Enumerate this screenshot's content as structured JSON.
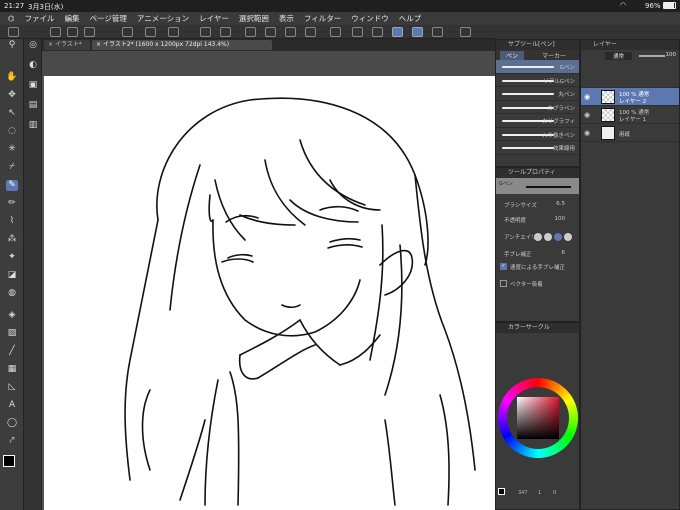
{
  "status": {
    "time": "21:27",
    "date": "3月3日(水)",
    "battery": "96%"
  },
  "menu": [
    "ファイル",
    "編集",
    "ページ管理",
    "アニメーション",
    "レイヤー",
    "選択範囲",
    "表示",
    "フィルター",
    "ウィンドウ",
    "ヘルプ"
  ],
  "tabs": [
    {
      "label": "イラスト*"
    },
    {
      "label": "イラスト2* (1600 x 1200px 72dpi 143.4%)"
    }
  ],
  "subtool_panel": {
    "title": "サブツール[ペン]",
    "tabs": [
      "ペン",
      "マーカー"
    ],
    "brushes": [
      "Gペン",
      "リアルGペン",
      "丸ペン",
      "カブラペン",
      "カリグラフィ",
      "入り抜きペン",
      "効果線用"
    ]
  },
  "tool_property": {
    "title": "ツールプロパティ",
    "brush_name": "Gペン",
    "brush_size_label": "ブラシサイズ",
    "brush_size": "6.5",
    "opacity_label": "不透明度",
    "opacity": "100",
    "antialias_label": "アンチエイリ",
    "stabilization_label": "手ブレ補正",
    "stabilization": "6",
    "speed_stab_label": "速度による手ブレ補正",
    "vector_snap_label": "ベクター吸着"
  },
  "layer_panel": {
    "title": "レイヤー",
    "blend_mode": "通常",
    "opacity": "100",
    "layers": [
      {
        "line1": "100 % 通常",
        "line2": "レイヤー 2",
        "selected": true
      },
      {
        "line1": "100 % 通常",
        "line2": "レイヤー 1",
        "selected": false
      },
      {
        "line1": "",
        "line2": "用紙",
        "selected": false
      }
    ]
  },
  "color_panel": {
    "title": "カラーサークル"
  },
  "footer": {
    "zoom": "347",
    "value2": "1",
    "value3": "0"
  },
  "colors": {
    "accent": "#5b78b0",
    "panel": "#3a3a3a"
  }
}
